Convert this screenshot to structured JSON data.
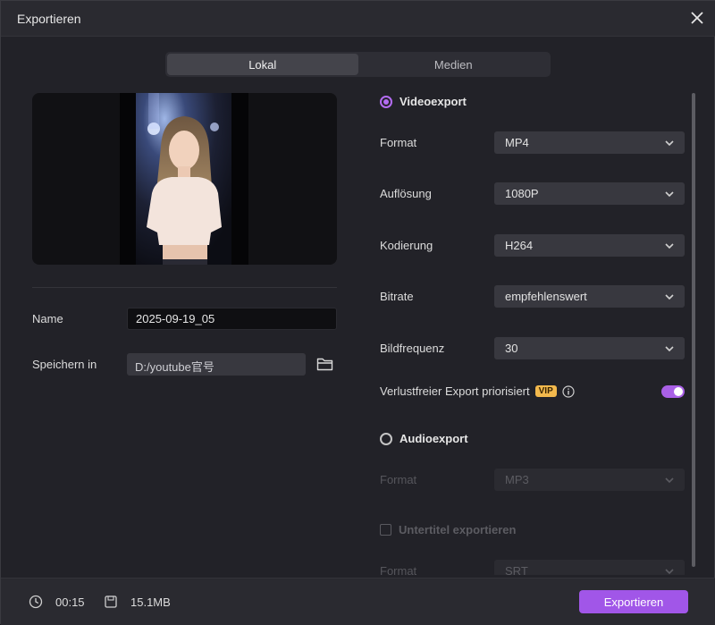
{
  "dialog": {
    "title": "Exportieren"
  },
  "tabs": [
    {
      "label": "Lokal",
      "active": true
    },
    {
      "label": "Medien",
      "active": false
    }
  ],
  "left": {
    "name_label": "Name",
    "name_value": "2025-09-19_05",
    "save_label": "Speichern in",
    "save_path": "D:/youtube官号"
  },
  "video": {
    "heading": "Videoexport",
    "selected": true,
    "rows": [
      {
        "label": "Format",
        "value": "MP4"
      },
      {
        "label": "Auflösung",
        "value": "1080P"
      },
      {
        "label": "Kodierung",
        "value": "H264"
      },
      {
        "label": "Bitrate",
        "value": "empfehlenswert"
      },
      {
        "label": "Bildfrequenz",
        "value": "30"
      }
    ],
    "lossless_label": "Verlustfreier Export priorisiert",
    "vip_badge": "VIP",
    "lossless_on": true
  },
  "audio": {
    "heading": "Audioexport",
    "selected": false,
    "format_label": "Format",
    "format_value": "MP3"
  },
  "subtitles": {
    "heading": "Untertitel exportieren",
    "checked": false,
    "format_label": "Format",
    "format_value": "SRT"
  },
  "footer": {
    "duration": "00:15",
    "size": "15.1MB",
    "export_label": "Exportieren"
  },
  "colors": {
    "accent": "#a156e8",
    "vip": "#f3b94d",
    "background": "#222228"
  }
}
